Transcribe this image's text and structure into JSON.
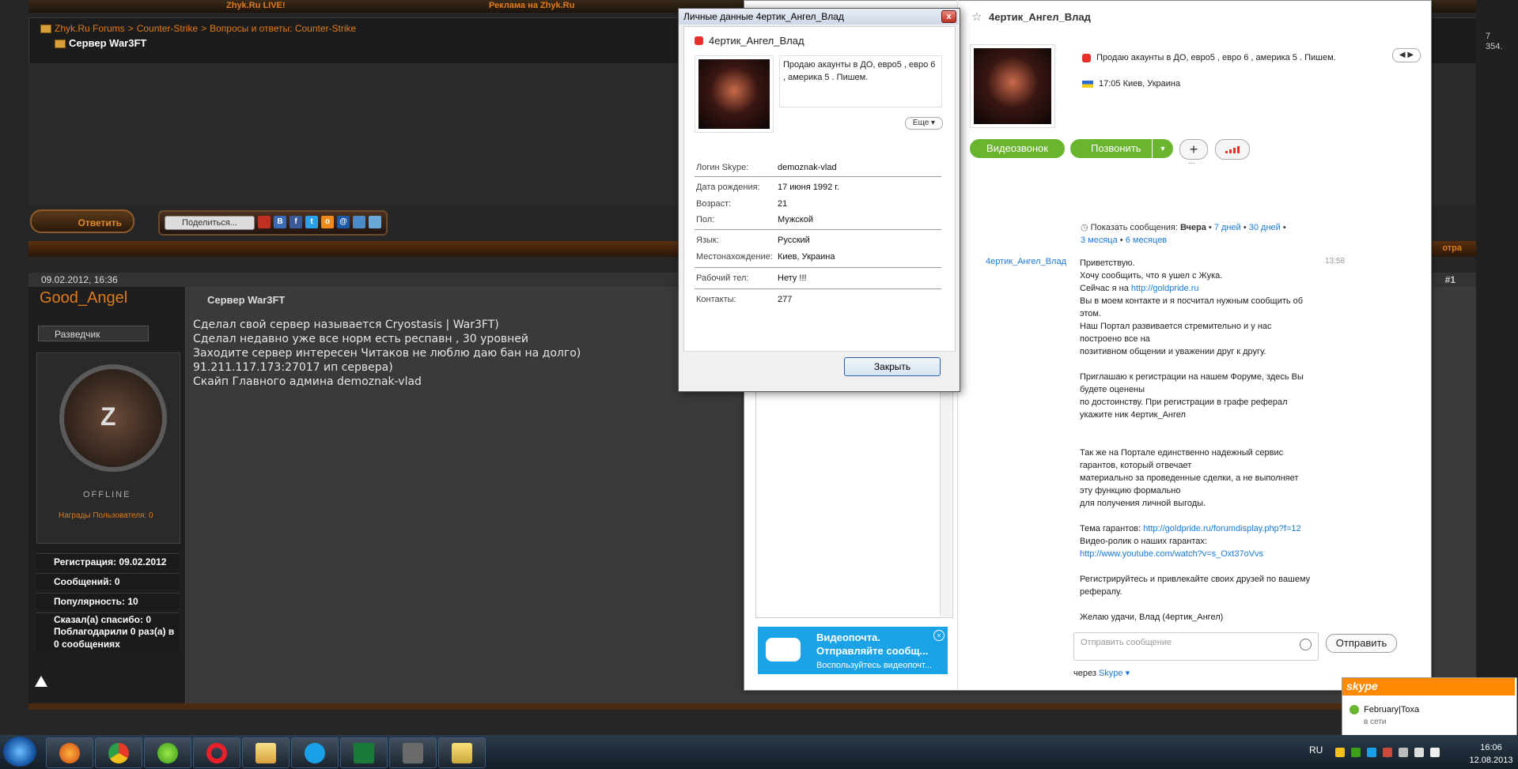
{
  "forum": {
    "top_links": [
      "Zhyk.Ru LIVE!",
      "Реклама на Zhyk.Ru"
    ],
    "breadcrumb": [
      "Zhyk.Ru Forums",
      "Counter-Strike",
      "Вопросы и ответы: Counter-Strike"
    ],
    "breadcrumb_sep": ">",
    "thread_title": "Сервер War3FT",
    "reply_label": "Ответить",
    "share_label": "Поделиться...",
    "right_edge_text": [
      "7",
      "354."
    ],
    "right_edge_link": "отра",
    "post": {
      "date": "09.02.2012, 16:36",
      "number": "#1",
      "username": "Good_Angel",
      "rank": "Разведчик",
      "avatar_letter": "Z",
      "status": "OFFLINE",
      "rewards": "Награды Пользователя: 0",
      "stats": [
        "Регистрация: 09.02.2012",
        "Сообщений: 0",
        "Популярность: 10",
        "Сказал(а) спасибо: 0",
        "Поблагодарили 0 раз(а) в",
        "0 сообщениях"
      ],
      "title": "Сервер War3FT",
      "lines": [
        "Сделал свой сервер называется Cryostasis | War3FT)",
        "Сделал недавно уже все норм есть респавн , 30 уровней",
        "Заходите сервер интересен Читаков не люблю даю бан на долго)",
        "91.211.117.173:27017 ип сервера)",
        "Скайп Главного админа demoznak-vlad"
      ]
    }
  },
  "skype": {
    "contact_name": "4ертик_Ангел_Влад",
    "mood": "Продаю акаунты в ДО, евро5 , евро 6 , америка 5 . Пишем.",
    "location": "17:05 Киев, Украина",
    "nav": "◀ ▶",
    "buttons": {
      "video": "Видеозвонок",
      "call": "Позвонить",
      "call_arrow": "▼",
      "add": "+",
      "more_dots": "..."
    },
    "history_label": "Показать сообщения:",
    "history_links": {
      "yesterday": "Вчера",
      "d7": "7 дней",
      "d30": "30 дней",
      "m3": "3 месяца",
      "m6": "6 месяцев"
    },
    "message": {
      "sender": "4ертик_Ангел_Влад",
      "time": "13:58",
      "lines": [
        "Приветствую.",
        "Хочу сообщить, что я ушел с Жука.",
        "Сейчас я на ",
        "Вы в моем контакте и я посчитал нужным сообщить об",
        "этом.",
        "Наш Портал развивается стремительно и у нас",
        "построено все на",
        "позитивном общении и уважении друг к другу.",
        "",
        "Приглашаю к регистрации на нашем Форуме, здесь Вы",
        "будете оценены",
        "по достоинству. При регистрации в графе реферал",
        "укажите ник 4ертик_Ангел",
        "",
        "",
        "Так же на Портале единственно надежный сервис",
        "гарантов, который отвечает",
        "материально за проведенные сделки, а не выполняет",
        "эту функцию формально",
        "для получения личной выгоды.",
        "",
        "Тема гарантов: ",
        "Видео-ролик о наших гарантах:",
        "",
        "",
        "Регистрируйтесь и привлекайте своих друзей по вашему",
        "рефералу.",
        "",
        "Желаю удачи, Влад (4ертик_Ангел)"
      ],
      "link_site": "http://goldpride.ru",
      "link_guarants": "http://goldpride.ru/forumdisplay.php?f=12",
      "link_video": "http://www.youtube.com/watch?v=s_Oxt37oVvs"
    },
    "input_placeholder": "Отправить сообщение",
    "send_label": "Отправить",
    "via_label": "через",
    "via_link": "Skype ▾",
    "videomail": {
      "title": "Видеопочта.",
      "subtitle": "Отправляйте сообщ...",
      "desc": "Воспользуйтесь видеопочт...",
      "close": "×"
    }
  },
  "profile_dialog": {
    "title": "Личные данные 4ертик_Ангел_Влад",
    "close_x": "x",
    "name": "4ертик_Ангел_Влад",
    "mood": "Продаю акаунты в ДО, евро5 , евро 6 , америка 5 . Пишем.",
    "more_label": "Еще ▾",
    "fields": [
      {
        "label": "Логин Skype:",
        "value": "demoznak-vlad"
      },
      {
        "label": "Дата рождения:",
        "value": "17 июня 1992 г."
      },
      {
        "label": "Возраст:",
        "value": "21"
      },
      {
        "label": "Пол:",
        "value": "Мужской"
      },
      {
        "label": "Язык:",
        "value": "Русский"
      },
      {
        "label": "Местонахождение:",
        "value": "Киев, Украина"
      },
      {
        "label": "Рабочий тел:",
        "value": "Нету !!!"
      },
      {
        "label": "Контакты:",
        "value": "277"
      }
    ],
    "close_button": "Закрыть"
  },
  "toast": {
    "logo": "skype",
    "name": "February|Toxa",
    "status": "в сети"
  },
  "taskbar": {
    "apps": [
      "firefox",
      "chrome",
      "icq",
      "opera",
      "explorer",
      "skype",
      "excel",
      "world-of-tanks",
      "folder"
    ],
    "lang": "RU",
    "time": "16:06",
    "date": "12.08.2013"
  }
}
